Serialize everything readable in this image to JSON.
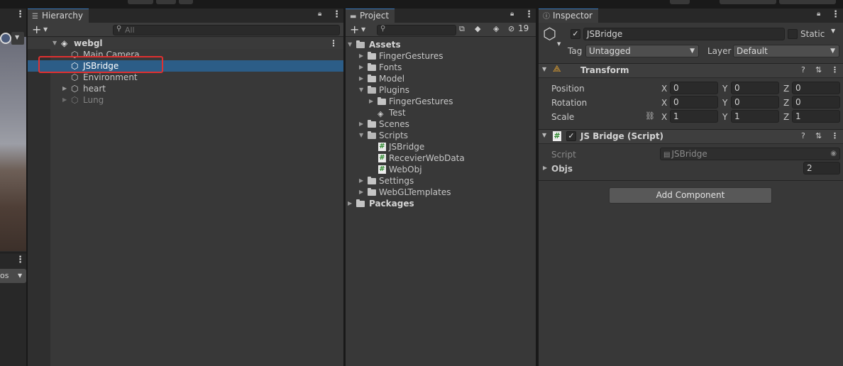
{
  "scene_panel": {
    "dropdown_text": "os"
  },
  "hierarchy": {
    "tab_title": "Hierarchy",
    "search_placeholder": "All",
    "items": [
      {
        "label": "webgl"
      },
      {
        "label": "Main Camera"
      },
      {
        "label": "JSBridge"
      },
      {
        "label": "Environment"
      },
      {
        "label": "heart"
      },
      {
        "label": "Lung"
      }
    ]
  },
  "project": {
    "tab_title": "Project",
    "hidden_count": "19",
    "items": [
      {
        "label": "Assets"
      },
      {
        "label": "FingerGestures"
      },
      {
        "label": "Fonts"
      },
      {
        "label": "Model"
      },
      {
        "label": "Plugins"
      },
      {
        "label": "FingerGestures"
      },
      {
        "label": "Test"
      },
      {
        "label": "Scenes"
      },
      {
        "label": "Scripts"
      },
      {
        "label": "JSBridge"
      },
      {
        "label": "RecevierWebData"
      },
      {
        "label": "WebObj"
      },
      {
        "label": "Settings"
      },
      {
        "label": "WebGLTemplates"
      },
      {
        "label": "Packages"
      }
    ]
  },
  "inspector": {
    "tab_title": "Inspector",
    "object_name": "JSBridge",
    "static_label": "Static",
    "tag_label": "Tag",
    "tag_value": "Untagged",
    "layer_label": "Layer",
    "layer_value": "Default",
    "transform": {
      "title": "Transform",
      "position_label": "Position",
      "rotation_label": "Rotation",
      "scale_label": "Scale",
      "axis_x": "X",
      "axis_y": "Y",
      "axis_z": "Z",
      "position": {
        "x": "0",
        "y": "0",
        "z": "0"
      },
      "rotation": {
        "x": "0",
        "y": "0",
        "z": "0"
      },
      "scale": {
        "x": "1",
        "y": "1",
        "z": "1"
      }
    },
    "script_component": {
      "title": "JS Bridge (Script)",
      "script_label": "Script",
      "script_value": "JSBridge",
      "objs_label": "Objs",
      "objs_value": "2"
    },
    "add_component_label": "Add Component"
  },
  "icons": {
    "hierarchy_tab": "list-icon",
    "inspector_tab": "info-icon",
    "lock": "lock-icon",
    "menu": "kebab-icon",
    "game_object": "cube-icon",
    "folder": "folder-icon",
    "script": "csharp-script-icon",
    "scene": "unity-scene-icon"
  },
  "colors": {
    "selection": "#2c5d87",
    "highlight": "#e03030",
    "panel_bg": "#383838",
    "script_icon": "#2e8a2e"
  }
}
